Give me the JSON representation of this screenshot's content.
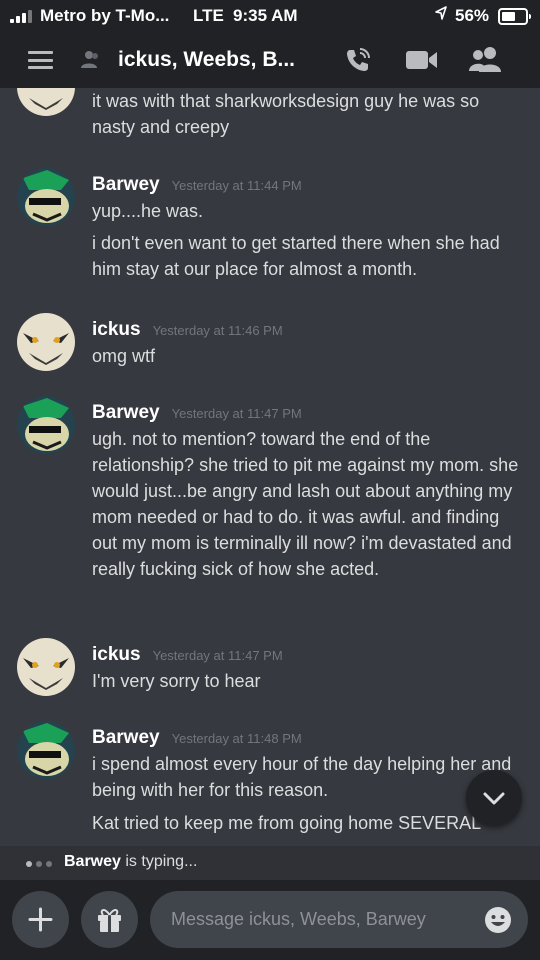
{
  "status_bar": {
    "carrier": "Metro by T-Mo...",
    "network": "LTE",
    "time": "9:35 AM",
    "battery": "56%"
  },
  "header": {
    "title": "ickus, Weebs, B..."
  },
  "messages": [
    {
      "type": "continuation",
      "text": "it was with that sharkworksdesign guy he was so nasty and creepy"
    },
    {
      "type": "group",
      "author": "Barwey",
      "timestamp": "Yesterday at 11:44 PM",
      "lines": [
        "yup....he was."
      ]
    },
    {
      "type": "continuation",
      "text": "i don't even want to get started there when she had him stay at our place for almost a month."
    },
    {
      "type": "group",
      "author": "ickus",
      "timestamp": "Yesterday at 11:46 PM",
      "lines": [
        "omg wtf"
      ]
    },
    {
      "type": "group",
      "author": "Barwey",
      "timestamp": "Yesterday at 11:47 PM",
      "lines": [
        "ugh. not to mention? toward the end of the relationship? she tried to pit me against my mom. she would just...be angry and lash out about anything my mom needed or had to do. it was awful. and finding out my mom is terminally ill now? i'm devastated and really fucking sick of how she acted."
      ]
    },
    {
      "type": "group",
      "author": "ickus",
      "timestamp": "Yesterday at 11:47 PM",
      "lines": [
        "I'm very sorry to hear"
      ]
    },
    {
      "type": "group",
      "author": "Barwey",
      "timestamp": "Yesterday at 11:48 PM",
      "lines": [
        "i spend almost every hour of the day helping her and being with her for this reason."
      ]
    },
    {
      "type": "continuation",
      "text": "Kat tried to keep me from going home SEVERAL"
    }
  ],
  "typing": {
    "user": "Barwey",
    "suffix": " is typing..."
  },
  "input": {
    "placeholder": "Message ickus, Weebs, Barwey"
  },
  "icons": [
    "menu-icon",
    "group-dm-icon",
    "call-icon",
    "video-icon",
    "members-icon",
    "chevron-down-icon",
    "plus-icon",
    "gift-icon",
    "emoji-icon"
  ],
  "colors": {
    "background": "#36393f",
    "header": "#202225",
    "text": "#dcddde",
    "muted": "#72767d"
  }
}
